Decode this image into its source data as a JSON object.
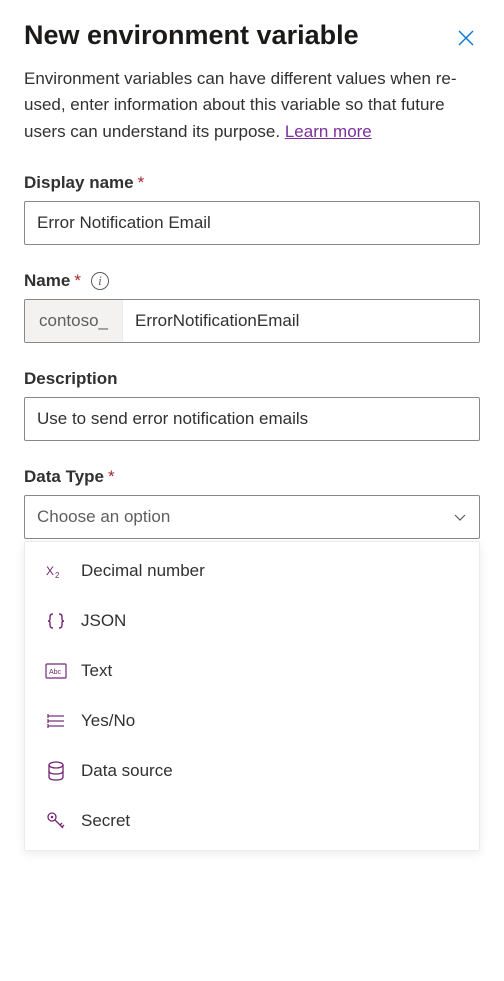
{
  "header": {
    "title": "New environment variable"
  },
  "intro": {
    "text": "Environment variables can have different values when re-used, enter information about this variable so that future users can understand its purpose. ",
    "learn_more": "Learn more"
  },
  "fields": {
    "display_name": {
      "label": "Display name",
      "value": "Error Notification Email"
    },
    "name": {
      "label": "Name",
      "prefix": "contoso_",
      "value": "ErrorNotificationEmail"
    },
    "description": {
      "label": "Description",
      "value": "Use to send error notification emails"
    },
    "data_type": {
      "label": "Data Type",
      "placeholder": "Choose an option",
      "options": [
        {
          "icon": "decimal",
          "label": "Decimal number"
        },
        {
          "icon": "json",
          "label": "JSON"
        },
        {
          "icon": "text",
          "label": "Text"
        },
        {
          "icon": "yesno",
          "label": "Yes/No"
        },
        {
          "icon": "datasource",
          "label": "Data source"
        },
        {
          "icon": "secret",
          "label": "Secret"
        }
      ]
    }
  }
}
